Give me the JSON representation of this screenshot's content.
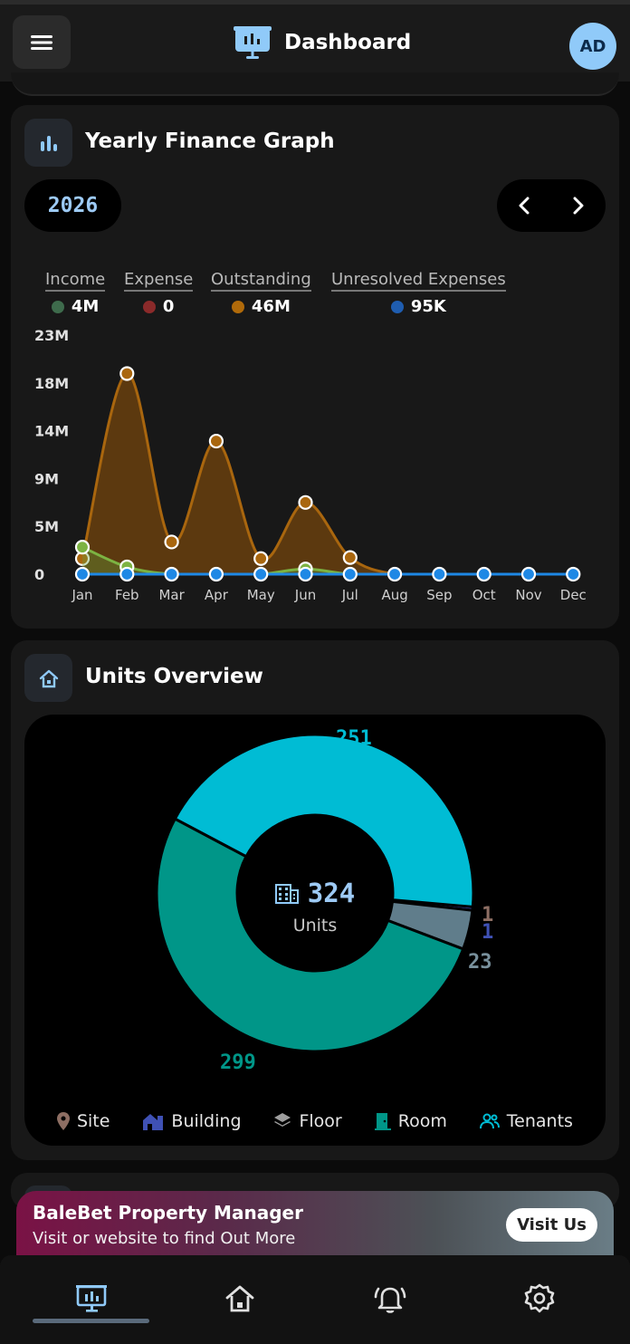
{
  "header": {
    "title": "Dashboard",
    "avatar_initials": "AD",
    "menu_icon": "hamburger-icon",
    "logo_icon": "presentation-icon"
  },
  "finance": {
    "title": "Yearly Finance Graph",
    "year": "2026",
    "legend": [
      {
        "label": "Income",
        "value": "4M",
        "color": "#3e6b4c"
      },
      {
        "label": "Expense",
        "value": "0",
        "color": "#8b2a2a"
      },
      {
        "label": "Outstanding",
        "value": "46M",
        "color": "#b06a0a"
      },
      {
        "label": "Unresolved Expenses",
        "value": "95K",
        "color": "#1f5db0"
      }
    ]
  },
  "chart_data": [
    {
      "type": "area",
      "title": "",
      "categories": [
        "Jan",
        "Feb",
        "Mar",
        "Apr",
        "May",
        "Jun",
        "Jul",
        "Aug",
        "Sep",
        "Oct",
        "Nov",
        "Dec"
      ],
      "y_ticks": [
        "0",
        "5M",
        "9M",
        "14M",
        "18M",
        "23M"
      ],
      "ylim": [
        0,
        23000000
      ],
      "grid": false,
      "legend_position": "top",
      "series": [
        {
          "name": "Income",
          "color": "#8bc34a",
          "values": [
            2600000,
            700000,
            0,
            0,
            0,
            500000,
            0,
            0,
            0,
            0,
            0,
            0
          ]
        },
        {
          "name": "Expense",
          "color": "#c0392b",
          "values": [
            0,
            0,
            0,
            0,
            0,
            0,
            0,
            0,
            0,
            0,
            0,
            0
          ]
        },
        {
          "name": "Outstanding",
          "color": "#c27c0e",
          "values": [
            1500000,
            19300000,
            3100000,
            12800000,
            1500000,
            6900000,
            1600000,
            0,
            0,
            0,
            0,
            0
          ]
        },
        {
          "name": "Unresolved Expenses",
          "color": "#1e88e5",
          "values": [
            0,
            0,
            0,
            0,
            0,
            0,
            0,
            0,
            0,
            0,
            0,
            0
          ]
        }
      ]
    },
    {
      "type": "pie",
      "title": "",
      "center_value": "324",
      "center_label": "Units",
      "slices": [
        {
          "name": "Site",
          "value": 1,
          "color": "#8d6e63"
        },
        {
          "name": "Building",
          "value": 1,
          "color": "#3f51b5"
        },
        {
          "name": "Floor",
          "value": 23,
          "color": "#607d8b"
        },
        {
          "name": "Room",
          "value": 299,
          "color": "#009688"
        },
        {
          "name": "Tenants",
          "value": 251,
          "color": "#00bcd4"
        }
      ]
    }
  ],
  "units": {
    "title": "Units Overview",
    "legend": [
      {
        "label": "Site",
        "icon": "map-pin-icon",
        "color": "#8d6e63"
      },
      {
        "label": "Building",
        "icon": "building-icon",
        "color": "#3f51b5"
      },
      {
        "label": "Floor",
        "icon": "layers-icon",
        "color": "#9e9e9e"
      },
      {
        "label": "Room",
        "icon": "door-icon",
        "color": "#009688"
      },
      {
        "label": "Tenants",
        "icon": "people-icon",
        "color": "#00bcd4"
      }
    ]
  },
  "banner": {
    "title": "BaleBet Property Manager",
    "subtitle": "Visit or website to find Out More",
    "button": "Visit Us"
  },
  "nav": [
    {
      "icon": "dashboard-icon",
      "active": true
    },
    {
      "icon": "home-icon",
      "active": false
    },
    {
      "icon": "bell-icon",
      "active": false
    },
    {
      "icon": "settings-icon",
      "active": false
    }
  ]
}
